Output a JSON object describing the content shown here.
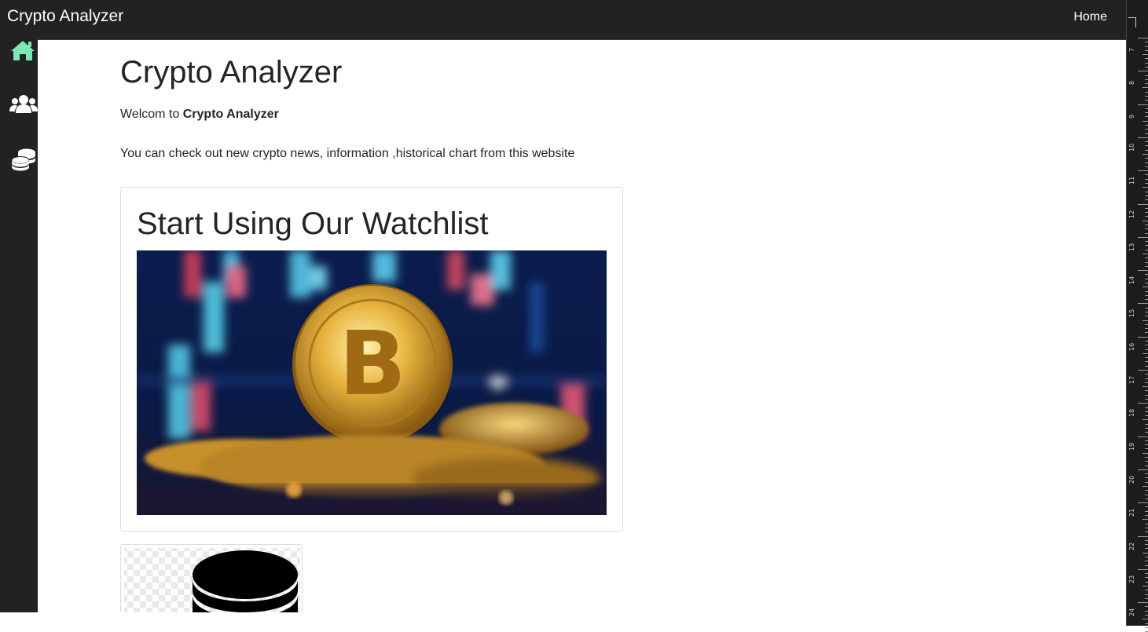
{
  "navbar": {
    "brand": "Crypto Analyzer",
    "home_link": "Home"
  },
  "sidebar": {
    "items": [
      {
        "icon": "home-icon",
        "color": "#7ee8b5"
      },
      {
        "icon": "users-icon",
        "color": "#ffffff"
      },
      {
        "icon": "coins-icon",
        "color": "#ffffff"
      }
    ]
  },
  "main": {
    "title": "Crypto Analyzer",
    "welcome_prefix": "Welcom to ",
    "welcome_bold": "Crypto Analyzer",
    "description": "You can check out new crypto news, information ,historical chart from this website",
    "card": {
      "heading": "Start Using Our Watchlist",
      "image": "bitcoin-banner-image"
    },
    "thumbnail": {
      "image": "coins-stack-image"
    }
  },
  "ruler": {
    "labels": [
      "7",
      "8",
      "9",
      "10",
      "11",
      "12",
      "13",
      "14",
      "15",
      "16",
      "17",
      "18",
      "19",
      "20",
      "21",
      "22",
      "23",
      "24"
    ]
  },
  "colors": {
    "dark": "#222222",
    "accent": "#7ee8b5",
    "text": "#212529",
    "border": "#dddddd"
  }
}
